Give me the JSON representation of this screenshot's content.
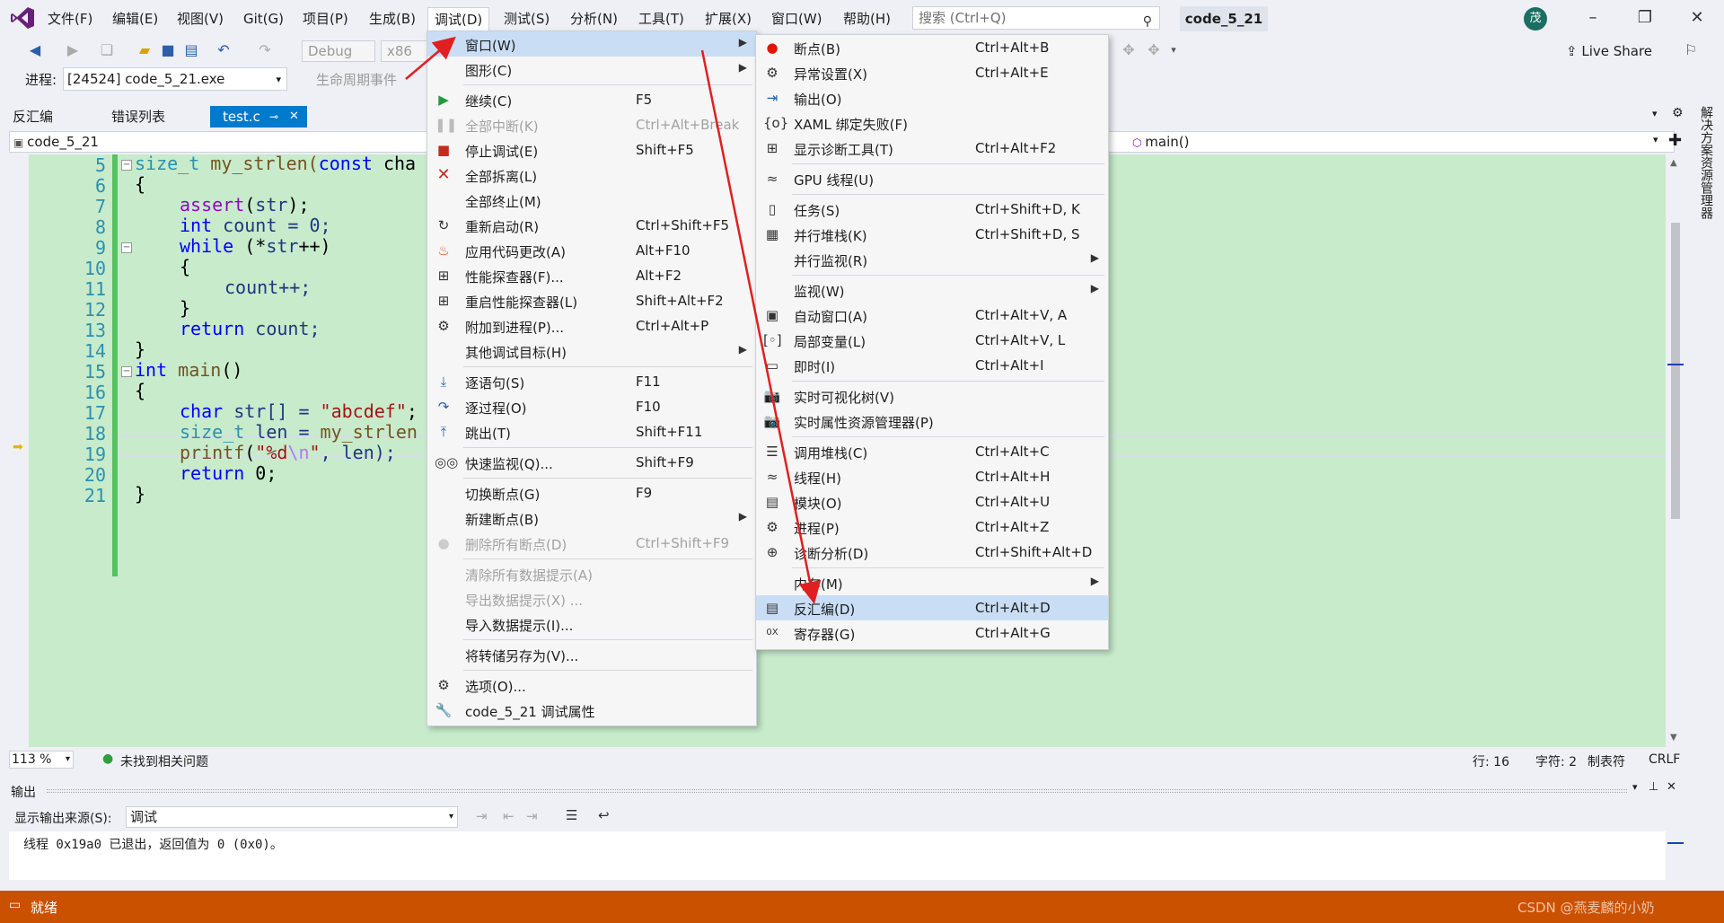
{
  "menubar": {
    "items": [
      "文件(F)",
      "编辑(E)",
      "视图(V)",
      "Git(G)",
      "项目(P)",
      "生成(B)",
      "调试(D)",
      "测试(S)",
      "分析(N)",
      "工具(T)",
      "扩展(X)",
      "窗口(W)",
      "帮助(H)"
    ],
    "search_placeholder": "搜索 (Ctrl+Q)",
    "solution_name": "code_5_21",
    "avatar": "茂"
  },
  "toolbar": {
    "config": "Debug",
    "platform": "x86",
    "process_label": "进程:",
    "process_value": "[24524] code_5_21.exe",
    "lifecycle_label": "生命周期事件",
    "live_share": "Live Share"
  },
  "tabs": [
    "反汇编",
    "错误列表",
    "test.c"
  ],
  "navbar": {
    "left": "code_5_21",
    "right": "main()"
  },
  "code_lines": [
    {
      "n": "5"
    },
    {
      "n": "6"
    },
    {
      "n": "7"
    },
    {
      "n": "8"
    },
    {
      "n": "9"
    },
    {
      "n": "10"
    },
    {
      "n": "11"
    },
    {
      "n": "12"
    },
    {
      "n": "13"
    },
    {
      "n": "14"
    },
    {
      "n": "15"
    },
    {
      "n": "16"
    },
    {
      "n": "17"
    },
    {
      "n": "18"
    },
    {
      "n": "19"
    },
    {
      "n": "20"
    },
    {
      "n": "21"
    }
  ],
  "code": {
    "l5_a": "size_t",
    "l5_b": " my_strlen(",
    "l5_c": "const",
    "l5_d": " cha",
    "l6": "{",
    "l7_a": "assert",
    "l7_b": "(",
    "l7_c": "str",
    "l7_d": ");",
    "l8_a": "int",
    "l8_b": " count = 0;",
    "l9_a": "while",
    "l9_b": " (*",
    "l9_c": "str",
    "l9_d": "++)",
    "l10": "{",
    "l11": "count++;",
    "l12": "}",
    "l13_a": "return",
    "l13_b": " count;",
    "l14": "}",
    "l15_a": "int",
    "l15_b": " main",
    "l15_c": "()",
    "l16": "{",
    "l17_a": "char",
    "l17_b": " str[] = ",
    "l17_c": "\"abcdef\"",
    "l17_d": ";",
    "l18_a": "size_t",
    "l18_b": " len = ",
    "l18_c": "my_strlen",
    "l19_a": "printf",
    "l19_b": "(",
    "l19_c": "\"%d",
    "l19_d": "\\n",
    "l19_e": "\"",
    "l19_f": ", len);",
    "l20_a": "return",
    "l20_b": " 0;",
    "l21": "}"
  },
  "editor_status": {
    "zoom": "113 %",
    "issues": "未找到相关问题",
    "line": "行: 16",
    "char": "字符: 2",
    "tabs": "制表符",
    "eol": "CRLF"
  },
  "output": {
    "title": "输出",
    "source_label": "显示输出来源(S):",
    "source_value": "调试",
    "text": "线程 0x19a0 已退出，返回值为 0 (0x0)。"
  },
  "statusbar": {
    "text": "就绪",
    "watermark": "CSDN @燕麦麟的小奶"
  },
  "side_tab": "解决方案资源管理器",
  "debug_menu": [
    {
      "label": "窗口(W)",
      "shortcut": "",
      "submenu": true
    },
    {
      "label": "图形(C)",
      "shortcut": "",
      "submenu": true
    },
    {
      "label": "继续(C)",
      "shortcut": "F5"
    },
    {
      "label": "全部中断(K)",
      "shortcut": "Ctrl+Alt+Break"
    },
    {
      "label": "停止调试(E)",
      "shortcut": "Shift+F5"
    },
    {
      "label": "全部拆离(L)",
      "shortcut": ""
    },
    {
      "label": "全部终止(M)",
      "shortcut": ""
    },
    {
      "label": "重新启动(R)",
      "shortcut": "Ctrl+Shift+F5"
    },
    {
      "label": "应用代码更改(A)",
      "shortcut": "Alt+F10"
    },
    {
      "label": "性能探查器(F)...",
      "shortcut": "Alt+F2"
    },
    {
      "label": "重启性能探查器(L)",
      "shortcut": "Shift+Alt+F2"
    },
    {
      "label": "附加到进程(P)...",
      "shortcut": "Ctrl+Alt+P"
    },
    {
      "label": "其他调试目标(H)",
      "shortcut": "",
      "submenu": true
    },
    {
      "label": "逐语句(S)",
      "shortcut": "F11"
    },
    {
      "label": "逐过程(O)",
      "shortcut": "F10"
    },
    {
      "label": "跳出(T)",
      "shortcut": "Shift+F11"
    },
    {
      "label": "快速监视(Q)...",
      "shortcut": "Shift+F9"
    },
    {
      "label": "切换断点(G)",
      "shortcut": "F9"
    },
    {
      "label": "新建断点(B)",
      "shortcut": "",
      "submenu": true
    },
    {
      "label": "删除所有断点(D)",
      "shortcut": "Ctrl+Shift+F9"
    },
    {
      "label": "清除所有数据提示(A)",
      "shortcut": ""
    },
    {
      "label": "导出数据提示(X) ...",
      "shortcut": ""
    },
    {
      "label": "导入数据提示(I)...",
      "shortcut": ""
    },
    {
      "label": "将转储另存为(V)...",
      "shortcut": ""
    },
    {
      "label": "选项(O)...",
      "shortcut": ""
    },
    {
      "label": "code_5_21 调试属性",
      "shortcut": ""
    }
  ],
  "window_menu": [
    {
      "label": "断点(B)",
      "shortcut": "Ctrl+Alt+B"
    },
    {
      "label": "异常设置(X)",
      "shortcut": "Ctrl+Alt+E"
    },
    {
      "label": "输出(O)",
      "shortcut": ""
    },
    {
      "label": "XAML 绑定失败(F)",
      "shortcut": ""
    },
    {
      "label": "显示诊断工具(T)",
      "shortcut": "Ctrl+Alt+F2"
    },
    {
      "label": "GPU 线程(U)",
      "shortcut": ""
    },
    {
      "label": "任务(S)",
      "shortcut": "Ctrl+Shift+D, K"
    },
    {
      "label": "并行堆栈(K)",
      "shortcut": "Ctrl+Shift+D, S"
    },
    {
      "label": "并行监视(R)",
      "shortcut": "",
      "submenu": true
    },
    {
      "label": "监视(W)",
      "shortcut": "",
      "submenu": true
    },
    {
      "label": "自动窗口(A)",
      "shortcut": "Ctrl+Alt+V, A"
    },
    {
      "label": "局部变量(L)",
      "shortcut": "Ctrl+Alt+V, L"
    },
    {
      "label": "即时(I)",
      "shortcut": "Ctrl+Alt+I"
    },
    {
      "label": "实时可视化树(V)",
      "shortcut": ""
    },
    {
      "label": "实时属性资源管理器(P)",
      "shortcut": ""
    },
    {
      "label": "调用堆栈(C)",
      "shortcut": "Ctrl+Alt+C"
    },
    {
      "label": "线程(H)",
      "shortcut": "Ctrl+Alt+H"
    },
    {
      "label": "模块(O)",
      "shortcut": "Ctrl+Alt+U"
    },
    {
      "label": "进程(P)",
      "shortcut": "Ctrl+Alt+Z"
    },
    {
      "label": "诊断分析(D)",
      "shortcut": "Ctrl+Shift+Alt+D"
    },
    {
      "label": "内存(M)",
      "shortcut": "",
      "submenu": true
    },
    {
      "label": "反汇编(D)",
      "shortcut": "Ctrl+Alt+D"
    },
    {
      "label": "寄存器(G)",
      "shortcut": "Ctrl+Alt+G"
    }
  ],
  "colors": {
    "accent": "#007acc",
    "status": "#ca5100",
    "editor_bg": "#c7ebcb",
    "highlight": "#c9def5",
    "annotation": "#e02020"
  }
}
